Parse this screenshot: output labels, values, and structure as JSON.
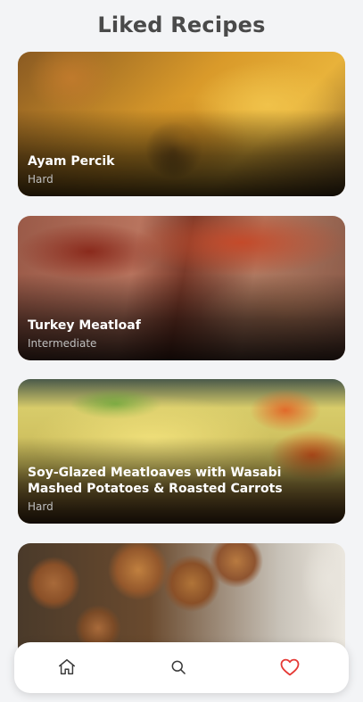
{
  "page": {
    "title": "Liked Recipes"
  },
  "recipes": [
    {
      "name": "Ayam Percik",
      "difficulty": "Hard"
    },
    {
      "name": "Turkey Meatloaf",
      "difficulty": "Intermediate"
    },
    {
      "name": "Soy-Glazed Meatloaves with Wasabi Mashed Potatoes & Roasted Carrots",
      "difficulty": "Hard"
    }
  ],
  "nav": {
    "items": [
      {
        "icon": "home-icon",
        "active": false
      },
      {
        "icon": "search-icon",
        "active": false
      },
      {
        "icon": "heart-icon",
        "active": true
      }
    ],
    "colors": {
      "inactive": "#3a3a3a",
      "active": "#e53935"
    }
  }
}
